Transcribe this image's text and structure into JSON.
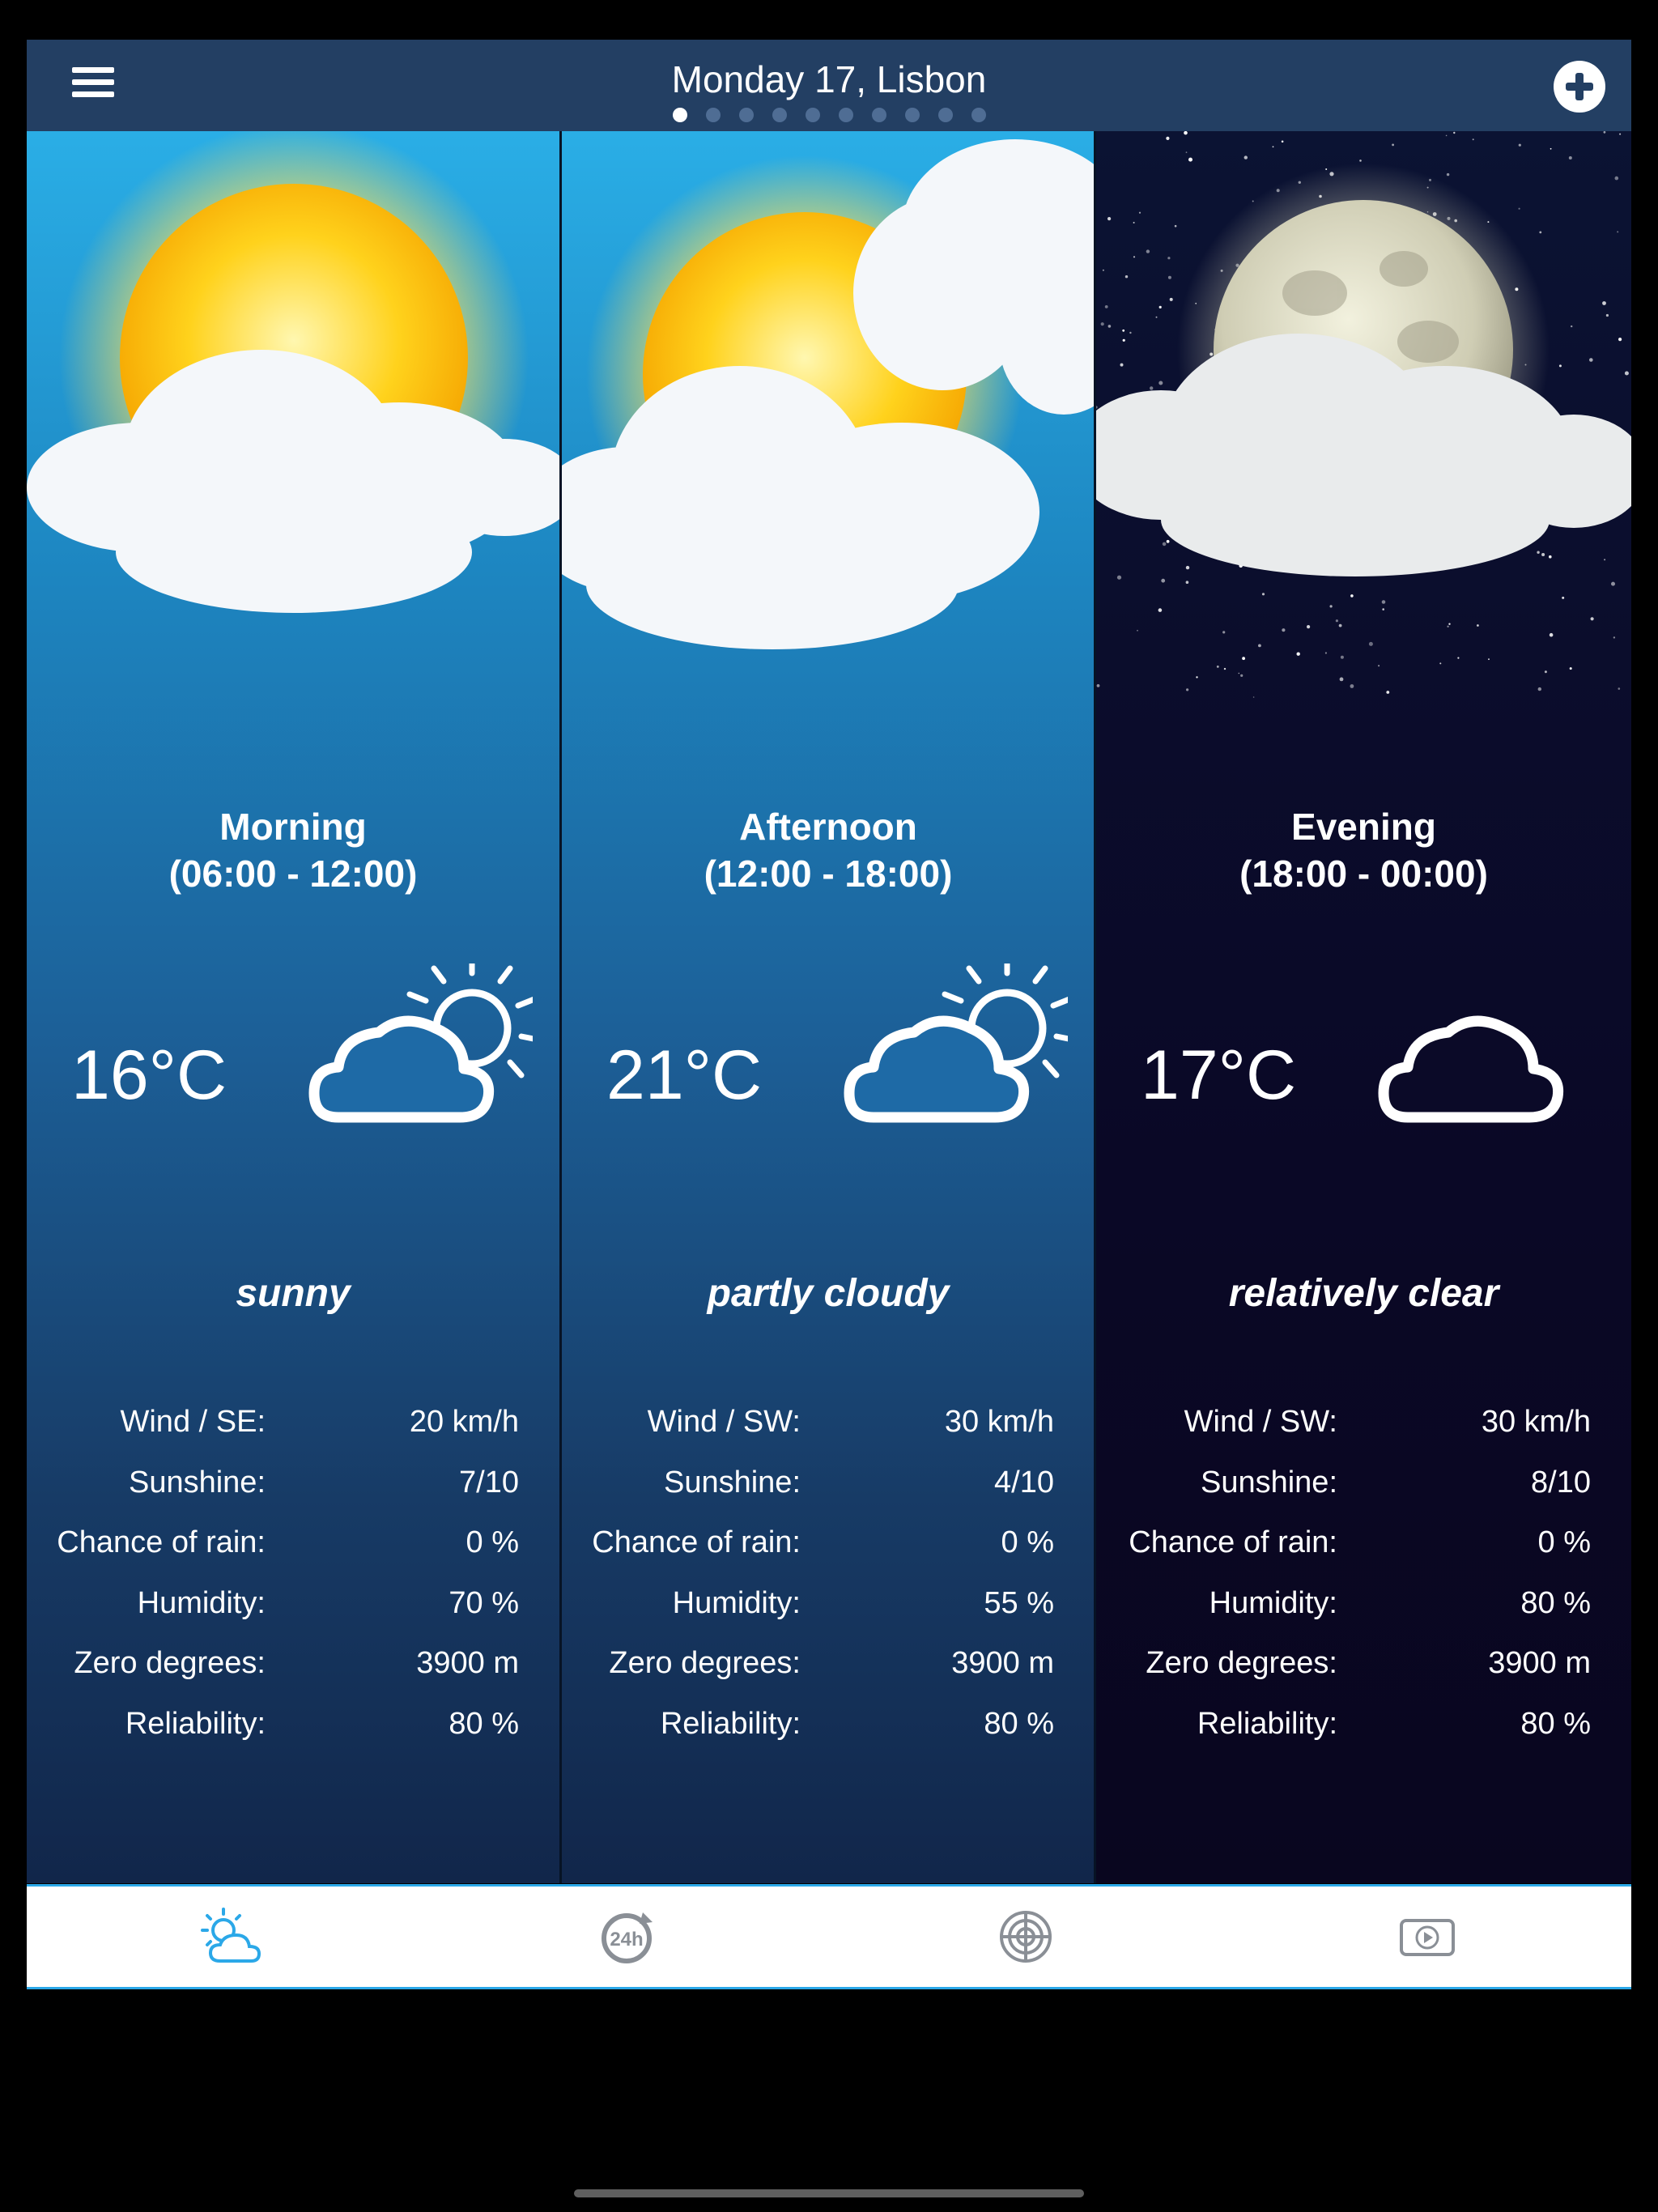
{
  "header": {
    "title": "Monday 17, Lisbon",
    "page_count": 10,
    "active_page": 0
  },
  "periods": [
    {
      "name": "Morning",
      "range": "(06:00 - 12:00)",
      "temperature": "16°C",
      "condition": "sunny",
      "icon": "cloud-sun-icon",
      "stats": [
        {
          "label": "Wind / SE:",
          "value": "20 km/h"
        },
        {
          "label": "Sunshine:",
          "value": "7/10"
        },
        {
          "label": "Chance of rain:",
          "value": "0 %"
        },
        {
          "label": "Humidity:",
          "value": "70 %"
        },
        {
          "label": "Zero degrees:",
          "value": "3900 m"
        },
        {
          "label": "Reliability:",
          "value": "80 %"
        }
      ]
    },
    {
      "name": "Afternoon",
      "range": "(12:00 - 18:00)",
      "temperature": "21°C",
      "condition": "partly cloudy",
      "icon": "cloud-sun-icon",
      "stats": [
        {
          "label": "Wind / SW:",
          "value": "30 km/h"
        },
        {
          "label": "Sunshine:",
          "value": "4/10"
        },
        {
          "label": "Chance of rain:",
          "value": "0 %"
        },
        {
          "label": "Humidity:",
          "value": "55 %"
        },
        {
          "label": "Zero degrees:",
          "value": "3900 m"
        },
        {
          "label": "Reliability:",
          "value": "80 %"
        }
      ]
    },
    {
      "name": "Evening",
      "range": "(18:00 - 00:00)",
      "temperature": "17°C",
      "condition": "relatively clear",
      "icon": "cloud-moon-icon",
      "stats": [
        {
          "label": "Wind / SW:",
          "value": "30 km/h"
        },
        {
          "label": "Sunshine:",
          "value": "8/10"
        },
        {
          "label": "Chance of rain:",
          "value": "0 %"
        },
        {
          "label": "Humidity:",
          "value": "80 %"
        },
        {
          "label": "Zero degrees:",
          "value": "3900 m"
        },
        {
          "label": "Reliability:",
          "value": "80 %"
        }
      ]
    }
  ],
  "tabs": [
    {
      "icon": "weather-icon",
      "active": true
    },
    {
      "icon": "24h-forecast-icon",
      "active": false
    },
    {
      "icon": "radar-icon",
      "active": false
    },
    {
      "icon": "video-icon",
      "active": false
    }
  ],
  "colors": {
    "header_bg": "#233f63",
    "accent": "#2ba8e8",
    "tab_inactive": "#8a8f96"
  }
}
